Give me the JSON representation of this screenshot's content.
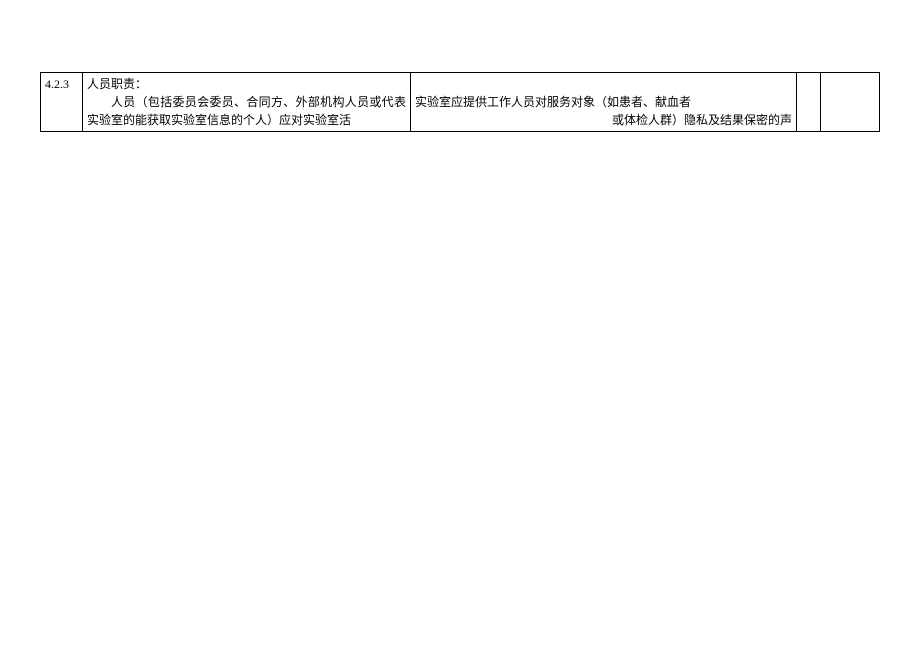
{
  "row": {
    "number": "4.2.3",
    "desc_title": "人员职责：",
    "desc_body": "人员（包括委员会委员、合同方、外部机构人员或代表实验室的能获取实验室信息的个人）应对实验室活",
    "requirement_line1": "实验室应提供工作人员对服务对象（如患者、献血者",
    "requirement_line2": "或体检人群）隐私及结果保密的声"
  }
}
